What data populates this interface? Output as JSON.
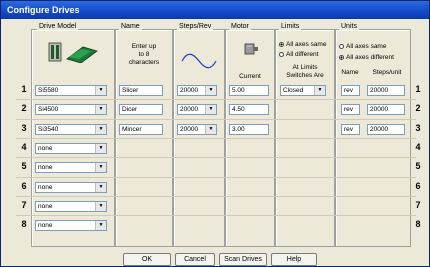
{
  "window": {
    "title": "Configure Drives"
  },
  "groups": {
    "drive_model": "Drive Model",
    "name": "Name",
    "steps": "Steps/Rev",
    "motor": "Motor",
    "limits": "Limits",
    "units": "Units"
  },
  "name_hint": [
    "Enter up",
    "to 8",
    "characters"
  ],
  "motor_current_label": "Current",
  "limits": {
    "option_same": "All axes same",
    "option_different": "All different",
    "switches_label": [
      "At Limits",
      "Switches Are"
    ],
    "value": "Closed"
  },
  "units": {
    "option_same": "All axes same",
    "option_different": "All axes different",
    "col_name": "Name",
    "col_steps": "Steps/unit"
  },
  "rows": [
    {
      "num": "1",
      "model": "Si5580",
      "name": "Slicer",
      "steps": "20000",
      "current": "5.00",
      "unit": "rev",
      "steps_unit": "20000"
    },
    {
      "num": "2",
      "model": "Si4500",
      "name": "Dicer",
      "steps": "20000",
      "current": "4.50",
      "unit": "rev",
      "steps_unit": "20000"
    },
    {
      "num": "3",
      "model": "Si3540",
      "name": "Mincer",
      "steps": "20000",
      "current": "3.00",
      "unit": "rev",
      "steps_unit": "20000"
    },
    {
      "num": "4",
      "model": "none"
    },
    {
      "num": "5",
      "model": "none"
    },
    {
      "num": "6",
      "model": "none"
    },
    {
      "num": "7",
      "model": "none"
    },
    {
      "num": "8",
      "model": "none"
    }
  ],
  "buttons": {
    "ok": "OK",
    "cancel": "Cancel",
    "scan": "Scan Drives",
    "help": "Help"
  },
  "icons": [
    "drive-icon",
    "sine-wave-icon",
    "motor-icon",
    "limit-switch-icon"
  ]
}
